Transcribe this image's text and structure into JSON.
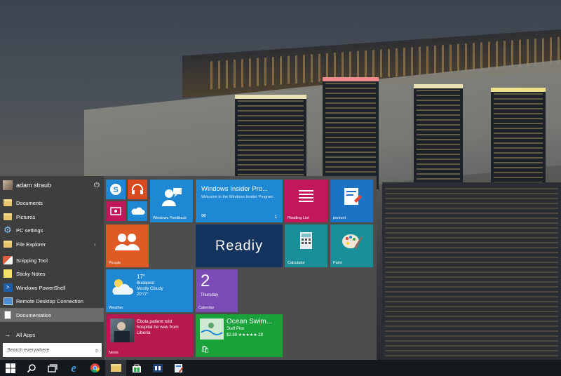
{
  "start_menu": {
    "user_name": "adam straub",
    "items": [
      {
        "label": "Documents",
        "icon": "folder-icon"
      },
      {
        "label": "Pictures",
        "icon": "folder-icon"
      },
      {
        "label": "PC settings",
        "icon": "gear-icon"
      },
      {
        "label": "File Explorer",
        "icon": "folder-icon",
        "arrow": "›"
      },
      {
        "label": "Snipping Tool",
        "icon": "snipping-tool-icon"
      },
      {
        "label": "Sticky Notes",
        "icon": "sticky-notes-icon"
      },
      {
        "label": "Windows PowerShell",
        "icon": "powershell-icon"
      },
      {
        "label": "Remote Desktop Connection",
        "icon": "remote-desktop-icon"
      },
      {
        "label": "Documentation",
        "icon": "document-icon"
      }
    ],
    "all_apps_label": "All Apps",
    "search_placeholder": "Search everywhere"
  },
  "tiles": {
    "windows_feedback": "Windows Feedback",
    "insider_title": "Windows Insider Pro...",
    "insider_sub": "Welcome to the Windows Insider Program",
    "insider_count": "1",
    "reading_list": "Reading List",
    "pentext": "pentext",
    "people": "People",
    "readiy": "Readiy",
    "calculator": "Calculator",
    "paint": "Paint",
    "weather_temp": "17°",
    "weather_city": "Budapest",
    "weather_cond": "Mostly Cloudy",
    "weather_range": "20°/7°",
    "weather_label": "Weather",
    "calendar_day": "2",
    "calendar_weekday": "Thursday",
    "calendar_label": "Calendar",
    "news_headline": "Ebola patient told hospital he was from Liberia",
    "news_label": "News",
    "store_title": "Ocean Swim...",
    "store_pick": "Staff Pick",
    "store_price": "$2.99 ★★★★★ 28"
  },
  "colors": {
    "skype": "#1e88d4",
    "music": "#d94a1e",
    "video": "#c2185b",
    "onedrive": "#1e88d4",
    "feedback": "#1e88d4",
    "insider": "#1e88d4",
    "reading": "#c2185b",
    "pentext": "#1a73c4",
    "people": "#e05a26",
    "readiy": "#14335e",
    "calculator": "#199099",
    "paint": "#199099",
    "weather": "#1e88d4",
    "calendar": "#7b4bb7",
    "news": "#b8174f",
    "store": "#1aa23a"
  }
}
